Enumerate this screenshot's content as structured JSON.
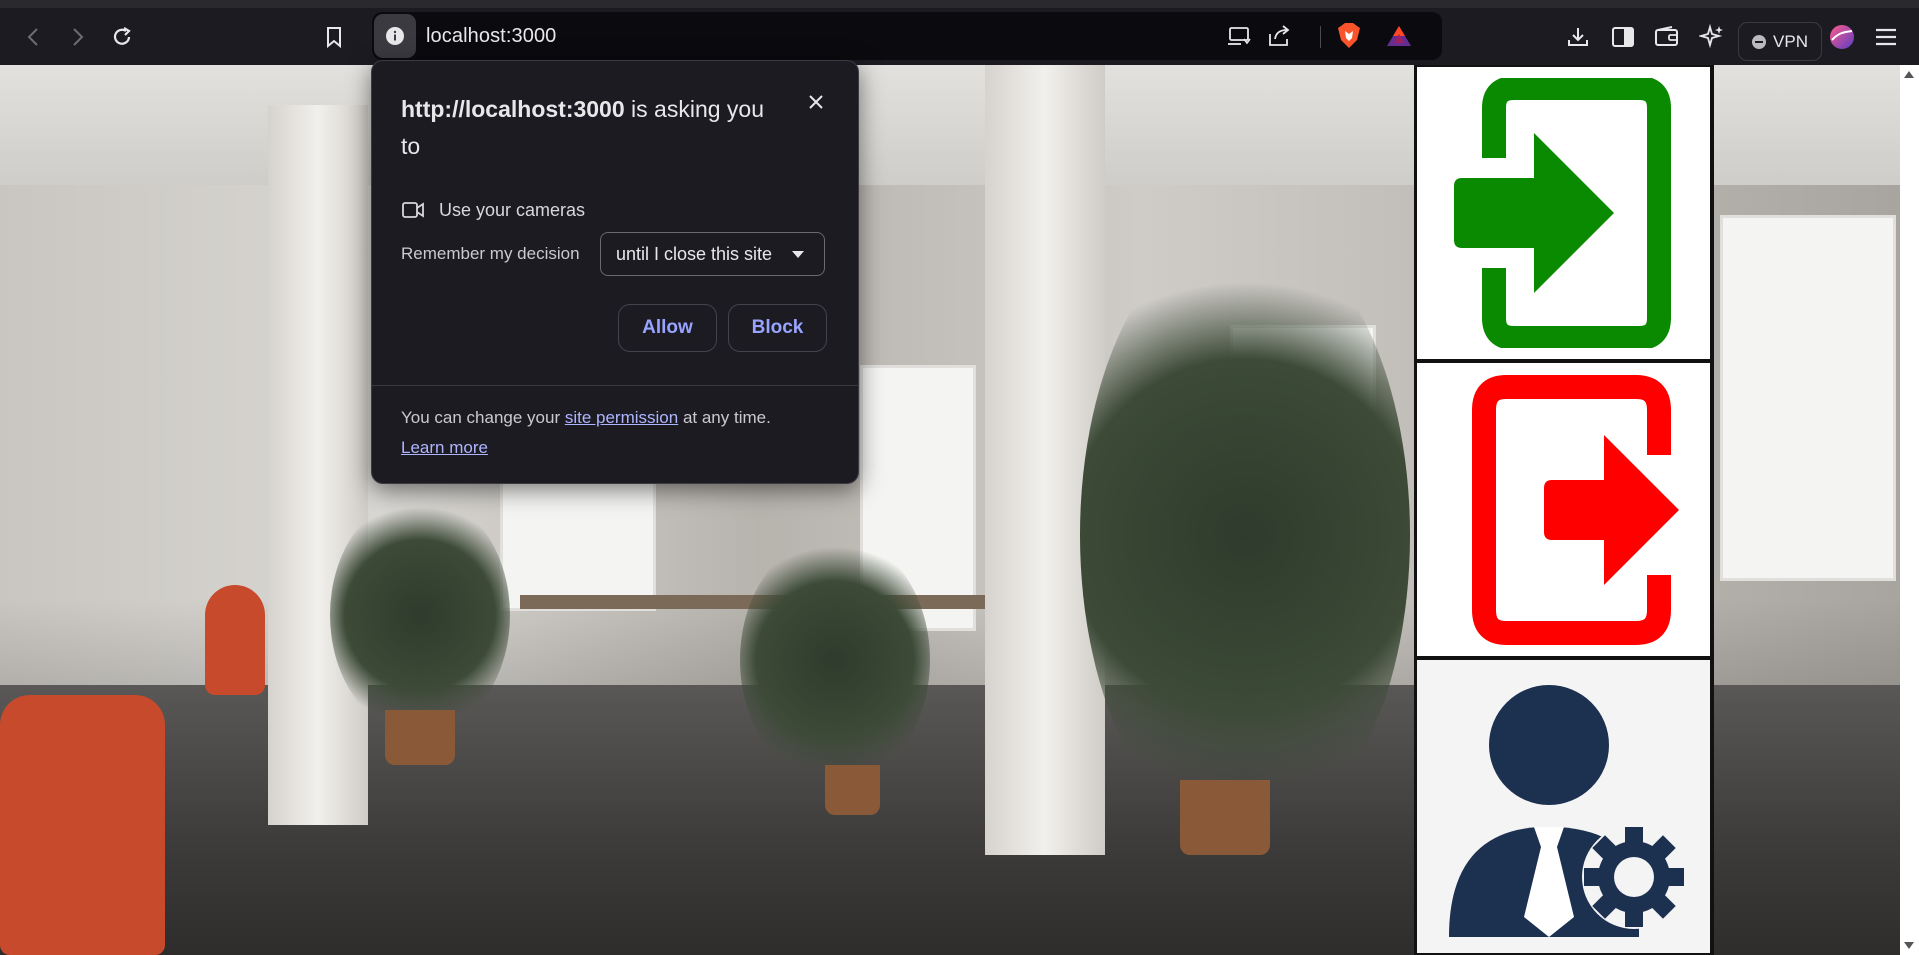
{
  "toolbar": {
    "url": "localhost:3000",
    "vpn_label": "VPN",
    "icons": [
      "back-icon",
      "forward-icon",
      "reload-icon",
      "bookmark-icon",
      "site-info-icon",
      "cast-icon",
      "share-icon",
      "brave-shields-icon",
      "brave-rewards-icon",
      "download-icon",
      "sidebar-icon",
      "wallet-icon",
      "leo-ai-icon",
      "vpn-icon",
      "profile-icon",
      "menu-icon"
    ]
  },
  "permission_prompt": {
    "origin": "http://localhost:3000",
    "title_suffix": "is asking you to",
    "request": "Use your cameras",
    "remember_label": "Remember my decision",
    "remember_value": "until I close this site",
    "allow_label": "Allow",
    "block_label": "Block",
    "footer_prefix": "You can change your",
    "footer_link": "site permission",
    "footer_suffix": "at any time.",
    "learn_more": "Learn more"
  },
  "page": {
    "tiles": [
      {
        "name": "login-icon",
        "color": "#0a8a00"
      },
      {
        "name": "logout-icon",
        "color": "#ff0000"
      },
      {
        "name": "admin-user-settings-icon",
        "color": "#1c3050"
      }
    ]
  },
  "colors": {
    "accent_button_text": "#98a4ff",
    "popup_bg": "#1c1b22",
    "toolbar_bg": "#1c1b22"
  }
}
